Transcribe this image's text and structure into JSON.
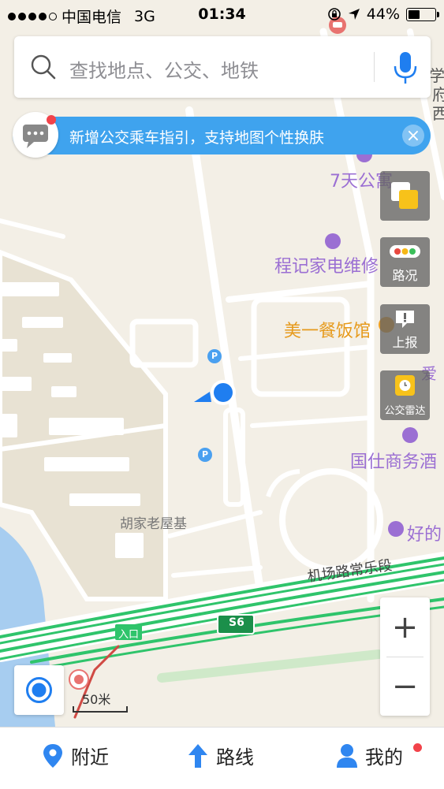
{
  "status_bar": {
    "carrier": "中国电信",
    "network": "3G",
    "time": "01:34",
    "battery_percent": "44%",
    "battery_level": 0.44
  },
  "search": {
    "placeholder": "查找地点、公交、地铁"
  },
  "banner": {
    "text": "新增公交乘车指引，支持地图个性换肤"
  },
  "side_buttons": {
    "traffic": "路况",
    "report": "上报",
    "bus_radar": "公交雷达"
  },
  "map_labels": {
    "hotel_7days": "7天公寓",
    "repair_shop": "程记家电维修",
    "restaurant": "美一餐饭馆",
    "guoshi": "国仕商务酒",
    "hao": "好的",
    "hujia": "胡家老屋基",
    "road": "机场路常乐段",
    "expressway": "S6",
    "entrance": "入口",
    "edge_xue": "学",
    "edge_fu": "府",
    "edge_xi": "西",
    "edge_ai": "爱",
    "parking": "P"
  },
  "scale": {
    "label": "50米"
  },
  "zoom": {
    "in": "+",
    "out": "−"
  },
  "tabs": {
    "nearby": "附近",
    "route": "路线",
    "mine": "我的"
  },
  "colors": {
    "accent": "#3fa3ee",
    "location": "#1f7ef0",
    "poi_purple": "#9b6fd3",
    "poi_orange": "#f0a020",
    "expressway_green": "#2fc46b",
    "badge_red": "#f2434a"
  }
}
